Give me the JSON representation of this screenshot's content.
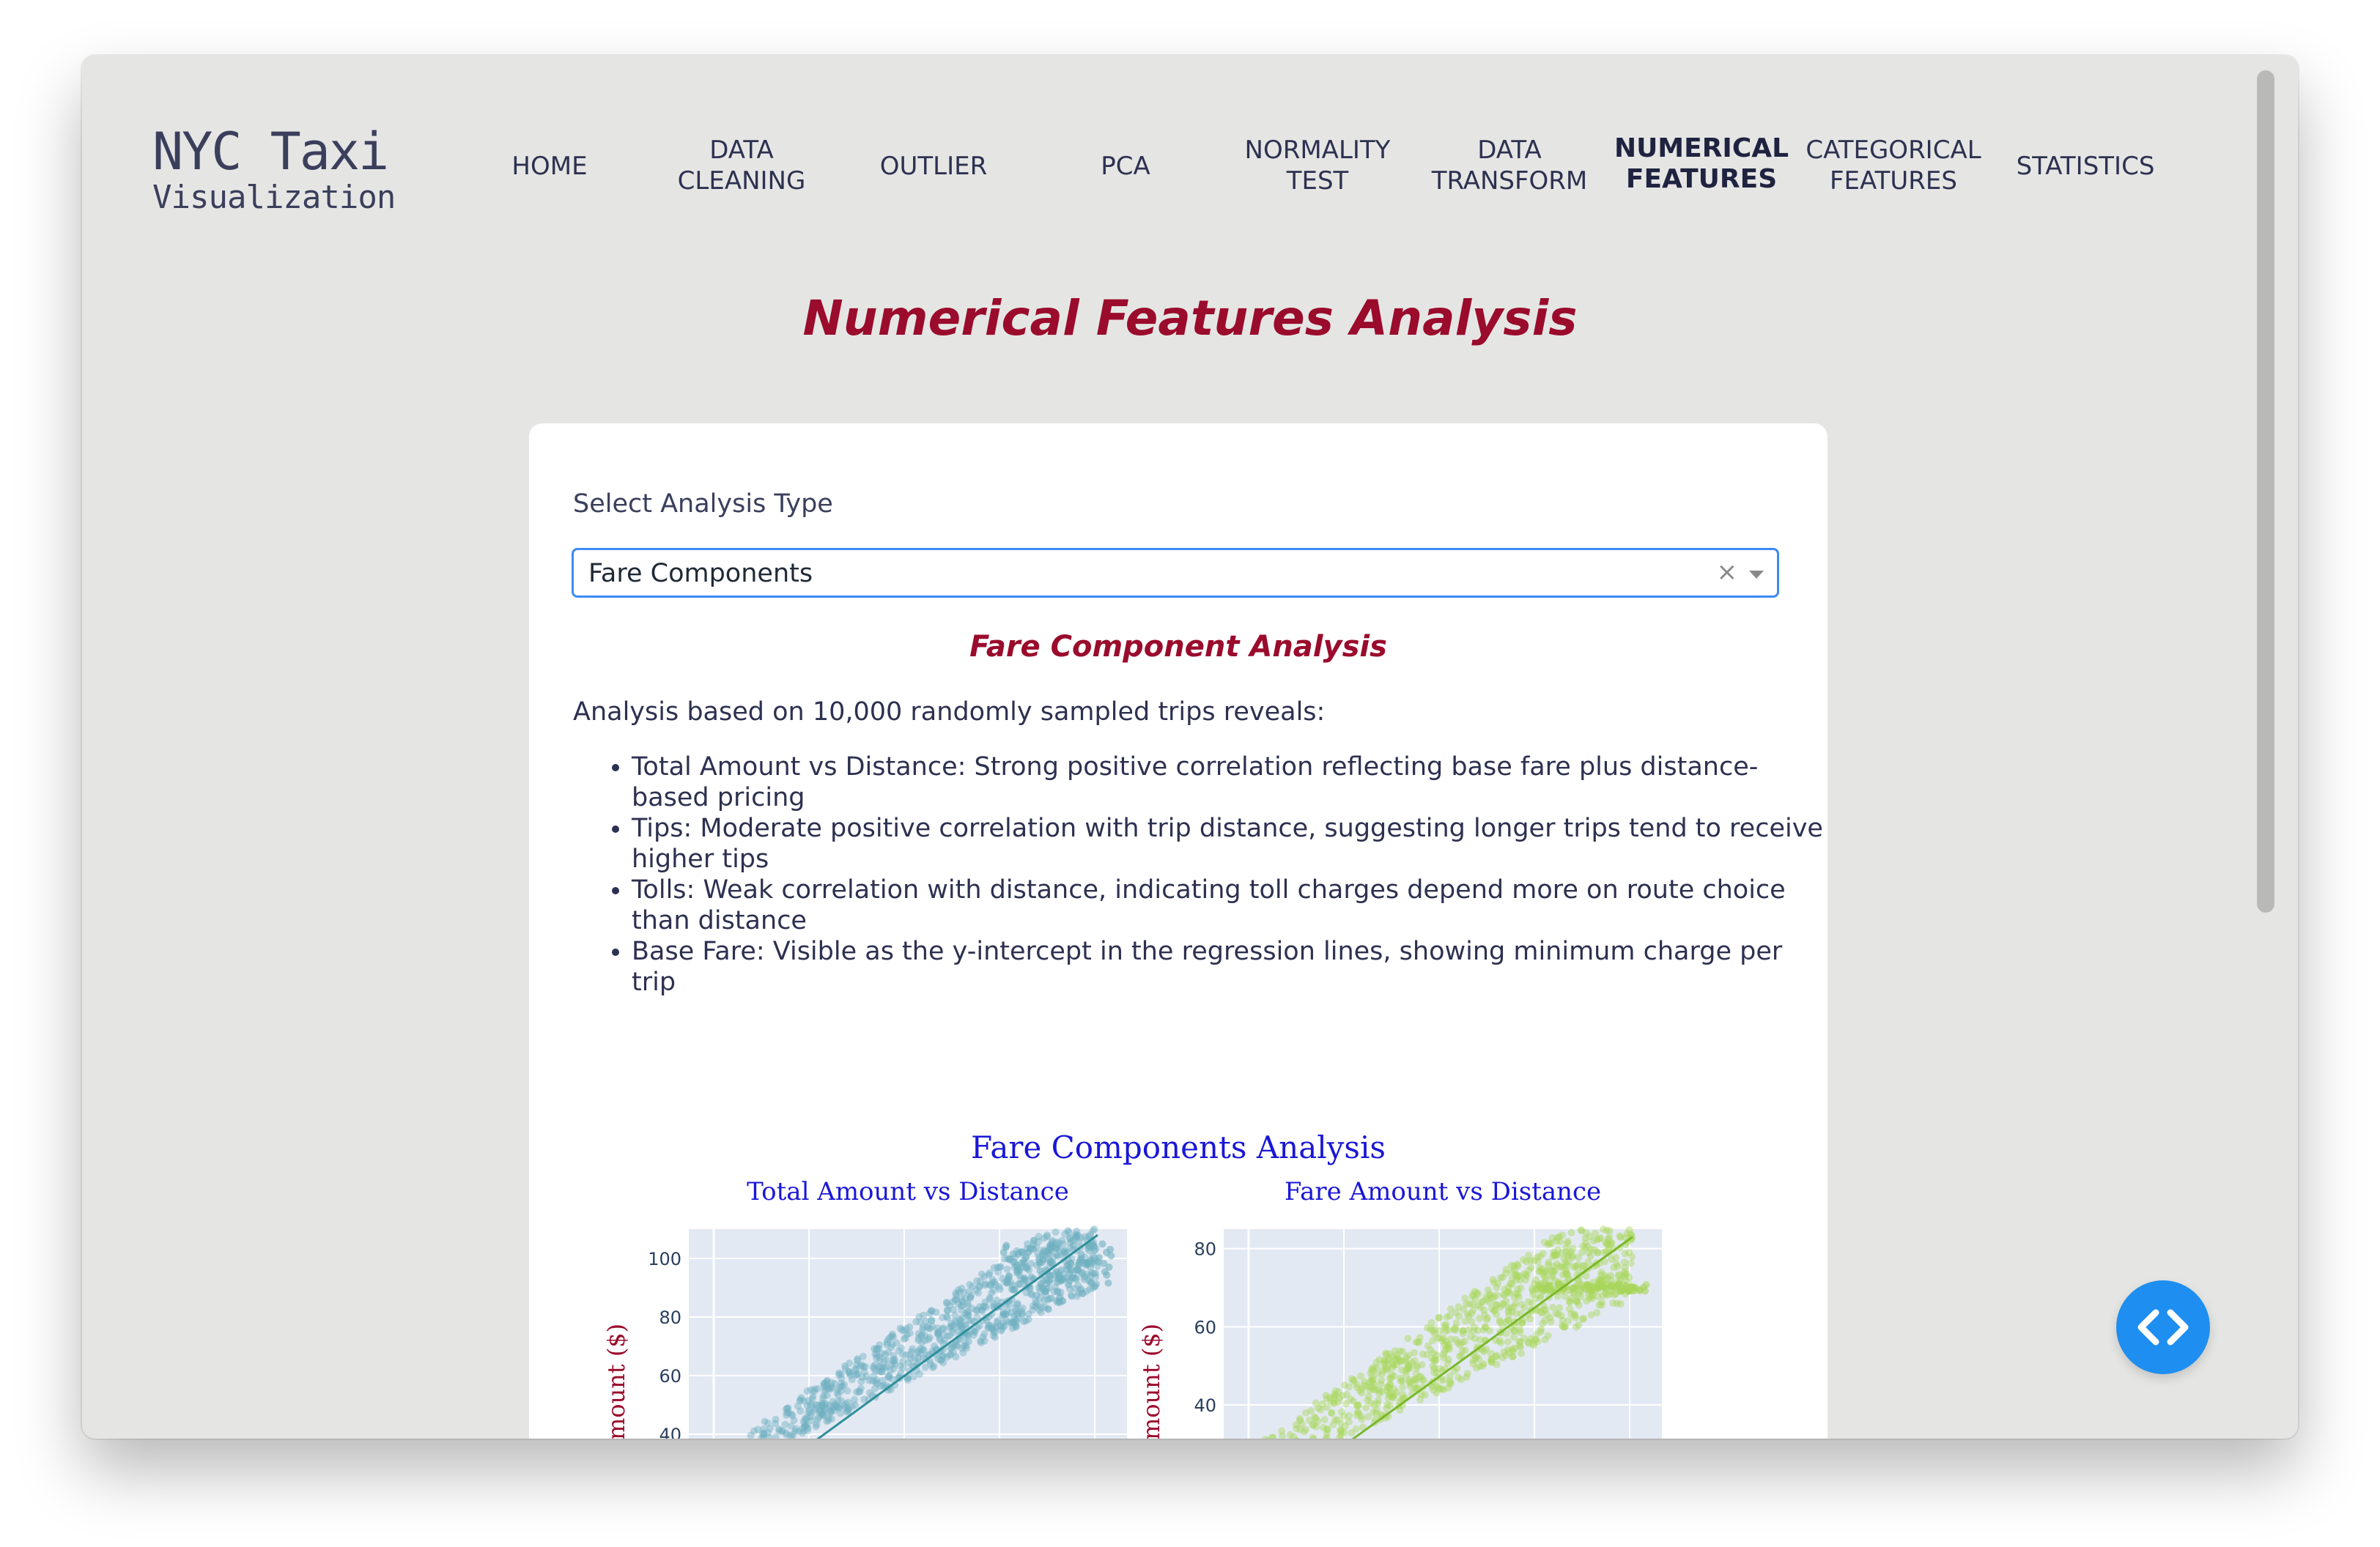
{
  "logo": {
    "line1": "NYC Taxi",
    "line2": "Visualization"
  },
  "nav": {
    "items": [
      {
        "label": "HOME"
      },
      {
        "label": "DATA\nCLEANING"
      },
      {
        "label": "OUTLIER"
      },
      {
        "label": "PCA"
      },
      {
        "label": "NORMALITY\nTEST"
      },
      {
        "label": "DATA\nTRANSFORM"
      },
      {
        "label": "NUMERICAL\nFEATURES",
        "active": true
      },
      {
        "label": "CATEGORICAL\nFEATURES"
      },
      {
        "label": "STATISTICS"
      }
    ]
  },
  "page": {
    "title": "Numerical Features Analysis"
  },
  "card": {
    "select_label": "Select Analysis Type",
    "select_value": "Fare Components",
    "clear_glyph": "×",
    "section_title": "Fare Component Analysis",
    "intro": "Analysis based on 10,000 randomly sampled trips reveals:",
    "bullets": [
      "Total Amount vs Distance: Strong positive correlation reflecting base fare plus distance-based pricing",
      "Tips: Moderate positive correlation with trip distance, suggesting longer trips tend to receive higher tips",
      "Tolls: Weak correlation with distance, indicating toll charges depend more on route choice than distance",
      "Base Fare: Visible as the y-intercept in the regression lines, showing minimum charge per trip"
    ]
  },
  "chart_data": {
    "title": "Fare Components Analysis",
    "subplots": [
      {
        "type": "scatter",
        "title": "Total Amount vs Distance",
        "ylabel": "Amount ($)",
        "yticks": [
          40,
          60,
          80,
          100
        ],
        "color": "#6fb0c0",
        "trend_color": "#2f8f9a"
      },
      {
        "type": "scatter",
        "title": "Fare Amount vs Distance",
        "ylabel": "Amount ($)",
        "yticks": [
          40,
          60,
          80
        ],
        "color": "#a8d65a",
        "trend_color": "#7ab82a"
      }
    ]
  },
  "colors": {
    "accent": "#9a0b2c",
    "link_blue": "#1a17d6",
    "fab": "#1e8ef0"
  },
  "fab": {
    "icon": "code-icon"
  }
}
